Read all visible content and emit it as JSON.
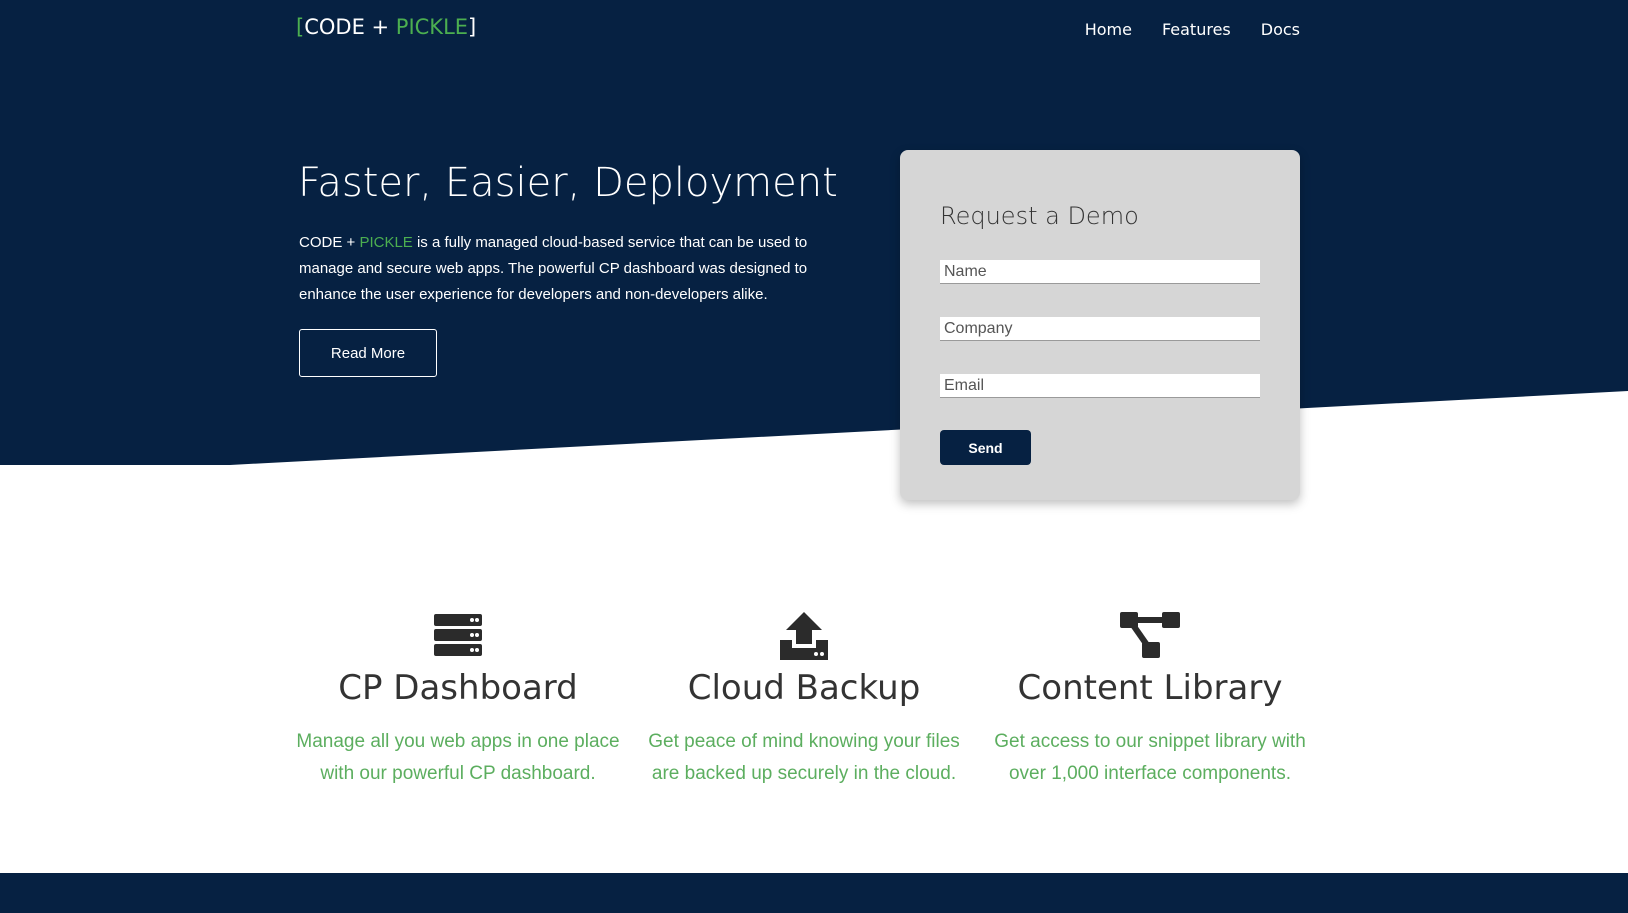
{
  "colors": {
    "navy": "#062142",
    "accent_green": "#4caf50",
    "card_gray": "#d6d6d6",
    "feature_text_green": "#5cae5f"
  },
  "header": {
    "brand_bracket_open": "[",
    "brand_code": "CODE + ",
    "brand_pickle": "PICKLE",
    "brand_bracket_close": "]",
    "nav": [
      {
        "label": "Home"
      },
      {
        "label": "Features"
      },
      {
        "label": "Docs"
      }
    ]
  },
  "hero": {
    "title": "Faster, Easier, Deployment",
    "desc_brand_code": "CODE + ",
    "desc_brand_pickle": "PICKLE",
    "desc_text": " is a fully managed cloud-based service that can be used to manage and secure web apps. The powerful CP dashboard was designed to enhance the user experience for developers and non-developers alike.",
    "read_more_label": "Read More"
  },
  "demo_form": {
    "title": "Request a Demo",
    "name_placeholder": "Name",
    "company_placeholder": "Company",
    "email_placeholder": "Email",
    "send_label": "Send"
  },
  "features": [
    {
      "icon": "server-icon",
      "title": "CP Dashboard",
      "desc": "Manage all you web apps in one place with our powerful CP dashboard."
    },
    {
      "icon": "upload-icon",
      "title": "Cloud Backup",
      "desc": "Get peace of mind knowing your files are backed up securely in the cloud."
    },
    {
      "icon": "sitemap-icon",
      "title": "Content Library",
      "desc": "Get access to our snippet library with over 1,000 interface components."
    }
  ]
}
